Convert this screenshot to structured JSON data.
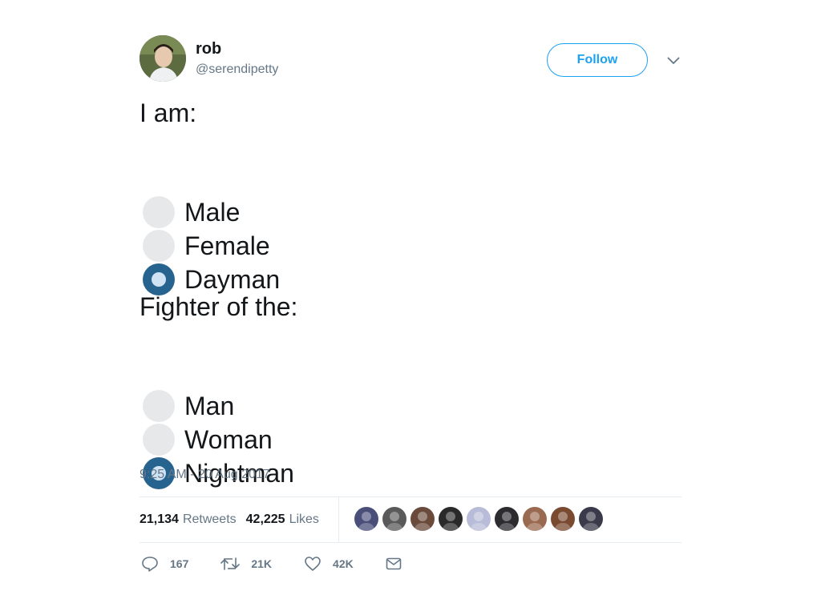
{
  "author": {
    "display_name": "rob",
    "handle": "@serendipetty",
    "avatar_icon": "profile-photo"
  },
  "header": {
    "follow_label": "Follow",
    "more_icon": "chevron-down-icon",
    "accent_color": "#1da1f2"
  },
  "tweet": {
    "intro_line": "I am:",
    "options_1": [
      {
        "label": "Male",
        "checked": false
      },
      {
        "label": "Female",
        "checked": false
      },
      {
        "label": "Dayman",
        "checked": true
      }
    ],
    "fighter_line": "Fighter of the:",
    "options_2": [
      {
        "label": "Man",
        "checked": false
      },
      {
        "label": "Woman",
        "checked": false
      },
      {
        "label": "Nightman",
        "checked": true
      }
    ],
    "timestamp": "9:25 AM - 20 Aug 2017"
  },
  "stats": {
    "retweets_count": "21,134",
    "retweets_label": "Retweets",
    "likes_count": "42,225",
    "likes_label": "Likes"
  },
  "likers": {
    "count_shown": 9,
    "colors": [
      "#4a4f7a",
      "#5a5a5a",
      "#6a4a3a",
      "#2a2a2a",
      "#b8bcd8",
      "#2b2b30",
      "#9a6a50",
      "#7a4a30",
      "#3a3a4a"
    ]
  },
  "actions": {
    "reply_count": "167",
    "retweet_count": "21K",
    "like_count": "42K",
    "reply_icon": "reply-icon",
    "retweet_icon": "retweet-icon",
    "like_icon": "heart-icon",
    "dm_icon": "envelope-icon"
  }
}
